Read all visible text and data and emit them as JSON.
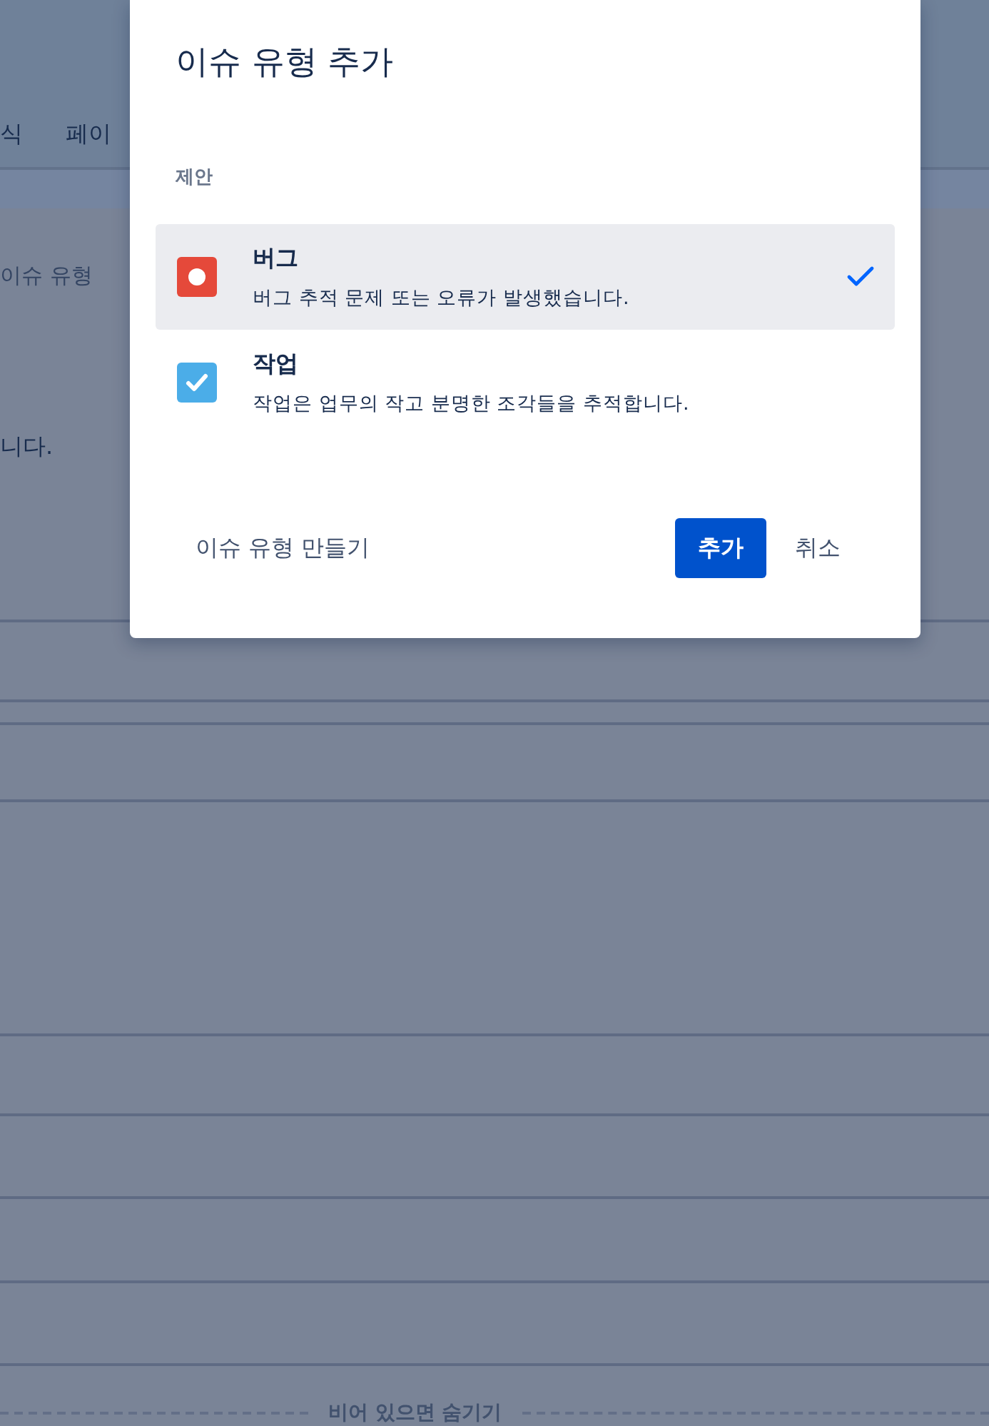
{
  "background": {
    "tabs": [
      {
        "label": "식"
      },
      {
        "label": "페이"
      }
    ],
    "section_label": "이슈 유형",
    "text_fragment": "니다.",
    "hide_toggle": "비어 있으면 숨기기"
  },
  "dialog": {
    "title": "이슈 유형 추가",
    "section_label": "제안",
    "options": [
      {
        "kind": "bug",
        "name": "버그",
        "description": "버그 추적 문제 또는 오류가 발생했습니다.",
        "selected": true
      },
      {
        "kind": "task",
        "name": "작업",
        "description": "작업은 업무의 작고 분명한 조각들을 추적합니다.",
        "selected": false
      }
    ],
    "create_link": "이슈 유형 만들기",
    "buttons": [
      {
        "label": "추가",
        "kind": "primary"
      },
      {
        "label": "취소",
        "kind": "subtle"
      }
    ]
  }
}
